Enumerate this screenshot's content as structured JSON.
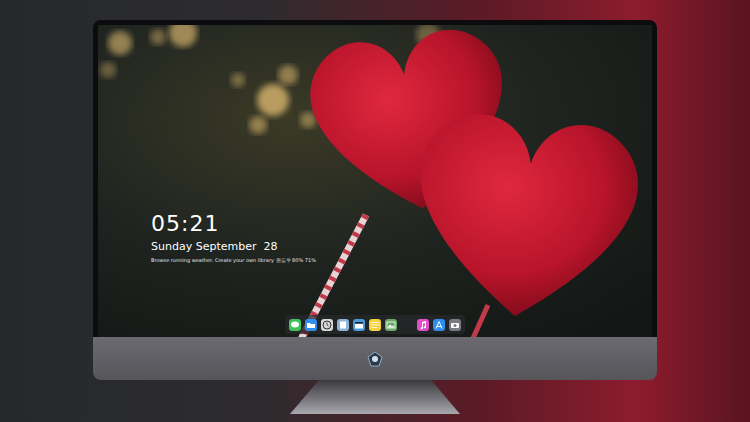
{
  "lockscreen": {
    "time": "05:21",
    "date": "Sunday September  28",
    "info": "Browse running weather. Create your own library 윈도우 80% 71%"
  }
}
